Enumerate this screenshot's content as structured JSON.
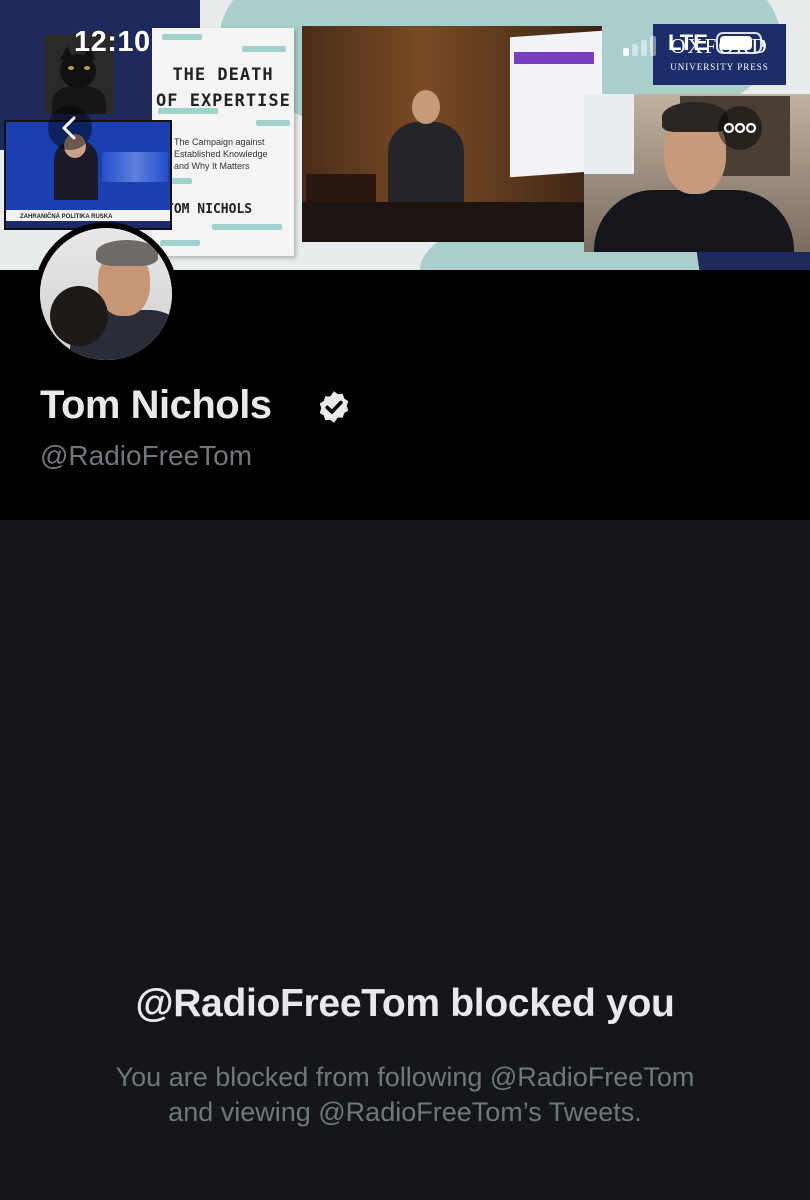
{
  "status_bar": {
    "time": "12:10",
    "network": "LTE"
  },
  "banner": {
    "book_title_line1": "THE DEATH",
    "book_title_line2": "OF EXPERTISE",
    "book_subtitle_line1": "The Campaign against",
    "book_subtitle_line2": "Established Knowledge",
    "book_subtitle_line3": "and Why It Matters",
    "book_author": "TOM NICHOLS",
    "publisher_line1": "OXFORD",
    "publisher_line2": "UNIVERSITY PRESS",
    "tv_ticker": "ZAHRANIČNÁ POLITIKA RUSKA"
  },
  "nav": {
    "back_icon": "chevron-left-icon",
    "more_icon": "more-horizontal-icon"
  },
  "profile": {
    "display_name": "Tom Nichols",
    "handle": "@RadioFreeTom",
    "verified": true,
    "accent_color": "#e7e9ea"
  },
  "blocked": {
    "title": "@RadioFreeTom blocked you",
    "description_line1": "You are blocked from following @RadioFreeTom",
    "description_line2": "and viewing @RadioFreeTom’s Tweets."
  },
  "colors": {
    "background": "#15161a",
    "header_background": "#000000",
    "primary_text": "#e7e9ea",
    "secondary_text": "#71767b"
  }
}
